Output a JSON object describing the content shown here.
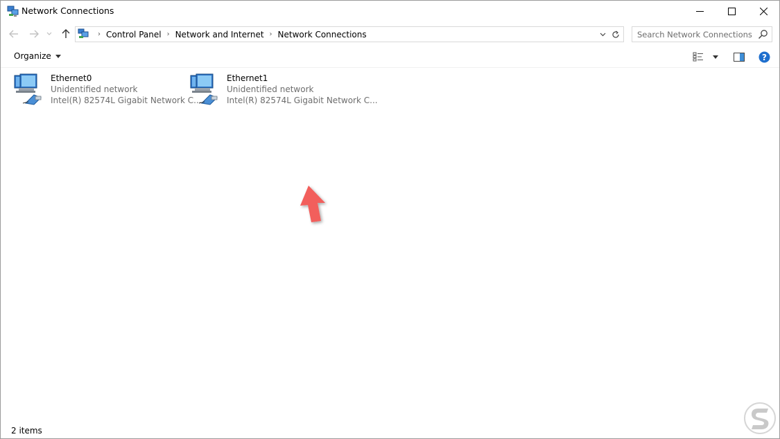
{
  "window": {
    "title": "Network Connections"
  },
  "address": {
    "breadcrumbs": [
      "Control Panel",
      "Network and Internet",
      "Network Connections"
    ]
  },
  "search": {
    "placeholder": "Search Network Connections"
  },
  "toolbar": {
    "organize_label": "Organize"
  },
  "connections": [
    {
      "name": "Ethernet0",
      "status": "Unidentified network",
      "device": "Intel(R) 82574L Gigabit Network C..."
    },
    {
      "name": "Ethernet1",
      "status": "Unidentified network",
      "device": "Intel(R) 82574L Gigabit Network C..."
    }
  ],
  "statusbar": {
    "item_count": "2 items"
  },
  "colors": {
    "accent": "#1a73c6",
    "help_blue": "#1e6fce",
    "annotation_arrow": "#f25f5c",
    "secondary_text": "#6d6d6d"
  },
  "icons": {
    "title": "network-connections-icon",
    "back": "arrow-left-icon",
    "forward": "arrow-right-icon",
    "up": "arrow-up-icon",
    "refresh": "refresh-icon",
    "search": "search-icon",
    "connection": "network-adapter-icon",
    "help": "help-icon"
  }
}
